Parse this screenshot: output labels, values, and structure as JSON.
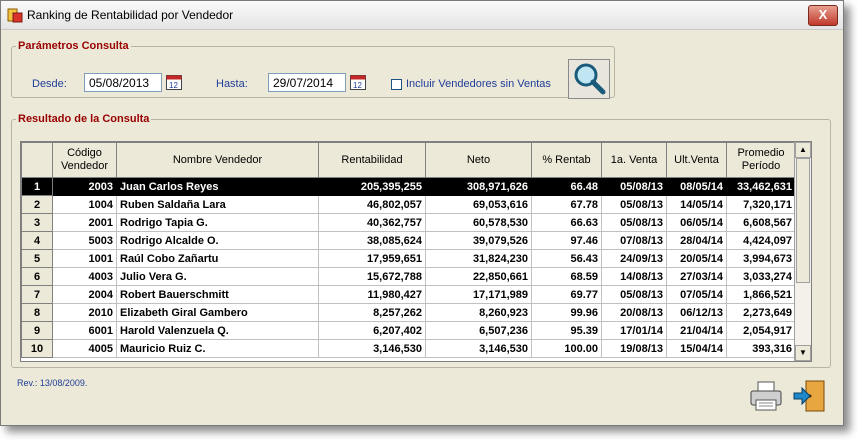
{
  "window": {
    "title": "Ranking de Rentabilidad por Vendedor",
    "close_glyph": "X"
  },
  "params": {
    "legend": "Parámetros Consulta",
    "desde_label": "Desde:",
    "desde_value": "05/08/2013",
    "hasta_label": "Hasta:",
    "hasta_value": "29/07/2014",
    "incluir_label": "Incluir Vendedores sin Ventas",
    "incluir_checked": false
  },
  "results": {
    "legend": "Resultado de la Consulta",
    "headers": {
      "codigo_l1": "Código",
      "codigo_l2": "Vendedor",
      "nombre": "Nombre Vendedor",
      "rentabilidad": "Rentabilidad",
      "neto": "Neto",
      "pct": "% Rentab",
      "primera": "1a. Venta",
      "ultima": "Ult.Venta",
      "promedio_l1": "Promedio",
      "promedio_l2": "Período"
    },
    "rows": [
      {
        "n": "1",
        "codigo": "2003",
        "nombre": "Juan Carlos Reyes",
        "rentabilidad": "205,395,255",
        "neto": "308,971,626",
        "pct": "66.48",
        "primera": "05/08/13",
        "ultima": "08/05/14",
        "promedio": "33,462,631",
        "selected": true
      },
      {
        "n": "2",
        "codigo": "1004",
        "nombre": "Ruben Saldaña Lara",
        "rentabilidad": "46,802,057",
        "neto": "69,053,616",
        "pct": "67.78",
        "primera": "05/08/13",
        "ultima": "14/05/14",
        "promedio": "7,320,171"
      },
      {
        "n": "3",
        "codigo": "2001",
        "nombre": "Rodrigo Tapia G.",
        "rentabilidad": "40,362,757",
        "neto": "60,578,530",
        "pct": "66.63",
        "primera": "05/08/13",
        "ultima": "06/05/14",
        "promedio": "6,608,567"
      },
      {
        "n": "4",
        "codigo": "5003",
        "nombre": "Rodrigo Alcalde O.",
        "rentabilidad": "38,085,624",
        "neto": "39,079,526",
        "pct": "97.46",
        "primera": "07/08/13",
        "ultima": "28/04/14",
        "promedio": "4,424,097"
      },
      {
        "n": "5",
        "codigo": "1001",
        "nombre": "Raúl Cobo Zañartu",
        "rentabilidad": "17,959,651",
        "neto": "31,824,230",
        "pct": "56.43",
        "primera": "24/09/13",
        "ultima": "20/05/14",
        "promedio": "3,994,673"
      },
      {
        "n": "6",
        "codigo": "4003",
        "nombre": "Julio Vera G.",
        "rentabilidad": "15,672,788",
        "neto": "22,850,661",
        "pct": "68.59",
        "primera": "14/08/13",
        "ultima": "27/03/14",
        "promedio": "3,033,274"
      },
      {
        "n": "7",
        "codigo": "2004",
        "nombre": "Robert Bauerschmitt",
        "rentabilidad": "11,980,427",
        "neto": "17,171,989",
        "pct": "69.77",
        "primera": "05/08/13",
        "ultima": "07/05/14",
        "promedio": "1,866,521"
      },
      {
        "n": "8",
        "codigo": "2010",
        "nombre": "Elizabeth Giral Gambero",
        "rentabilidad": "8,257,262",
        "neto": "8,260,923",
        "pct": "99.96",
        "primera": "20/08/13",
        "ultima": "06/12/13",
        "promedio": "2,273,649"
      },
      {
        "n": "9",
        "codigo": "6001",
        "nombre": "Harold Valenzuela Q.",
        "rentabilidad": "6,207,402",
        "neto": "6,507,236",
        "pct": "95.39",
        "primera": "17/01/14",
        "ultima": "21/04/14",
        "promedio": "2,054,917"
      },
      {
        "n": "10",
        "codigo": "4005",
        "nombre": "Mauricio Ruiz C.",
        "rentabilidad": "3,146,530",
        "neto": "3,146,530",
        "pct": "100.00",
        "primera": "19/08/13",
        "ultima": "15/04/14",
        "promedio": "393,316"
      }
    ]
  },
  "footer": {
    "rev": "Rev.: 13/08/2009."
  },
  "icons": {
    "app": "app-icon",
    "calendar": "calendar-icon",
    "search": "magnifier-icon",
    "print": "printer-icon",
    "exit": "exit-door-icon"
  }
}
